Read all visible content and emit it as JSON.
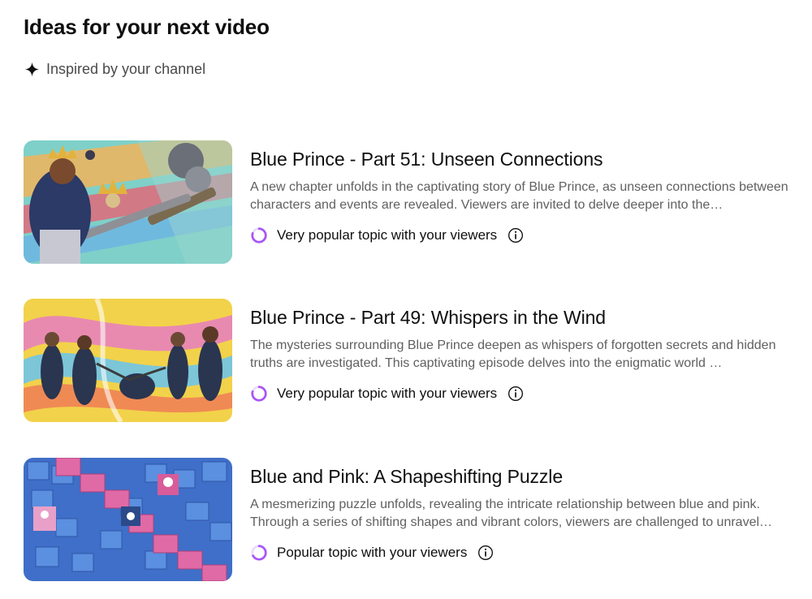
{
  "header": {
    "title": "Ideas for your next video",
    "subtitle": "Inspired by your channel",
    "subtitle_icon": "sparkle-icon"
  },
  "ideas": [
    {
      "title": "Blue Prince - Part 51: Unseen Connections",
      "description": "A new chapter unfolds in the captivating story of Blue Prince, as unseen connections between characters and events are revealed. Viewers are invited to delve deeper into the…",
      "popularity": "Very popular topic with your viewers"
    },
    {
      "title": "Blue Prince - Part 49: Whispers in the Wind",
      "description": "The mysteries surrounding Blue Prince deepen as whispers of forgotten secrets and hidden truths are investigated. This captivating episode delves into the enigmatic world …",
      "popularity": "Very popular topic with your viewers"
    },
    {
      "title": "Blue and Pink: A Shapeshifting Puzzle",
      "description": "A mesmerizing puzzle unfolds, revealing the intricate relationship between blue and pink. Through a series of shifting shapes and vibrant colors, viewers are challenged to unravel…",
      "popularity": "Popular topic with your viewers"
    }
  ],
  "colors": {
    "popularity_ring": "#a855f7",
    "popularity_ring_track": "#e9ddfb"
  }
}
